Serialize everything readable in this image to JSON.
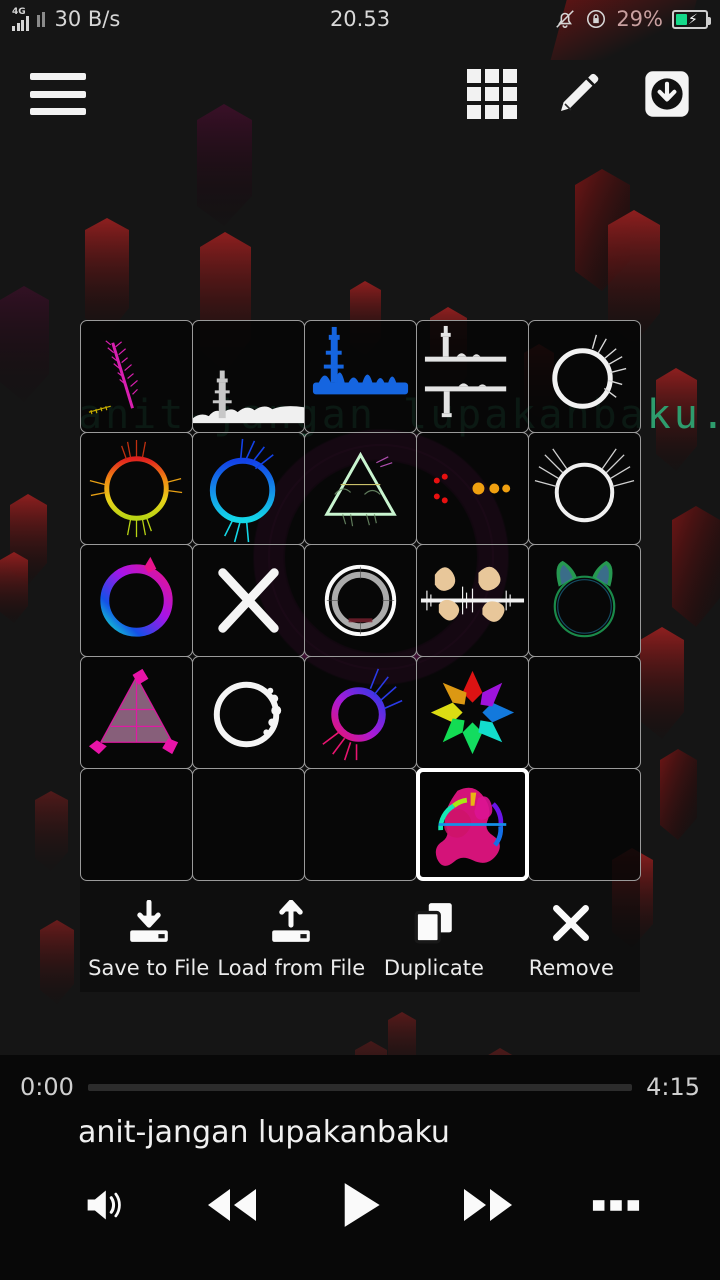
{
  "statusbar": {
    "network_type": "4G",
    "data_rate": "30 B/s",
    "clock": "20.53",
    "battery_percent": "29%",
    "icons": [
      "signal-bars-icon",
      "silent-bell-icon",
      "rotation-lock-icon",
      "battery-charging-icon"
    ]
  },
  "toolbar": {
    "menu_icon": "hamburger-menu-icon",
    "grid_icon": "grid-view-icon",
    "edit_icon": "pencil-edit-icon",
    "download_icon": "download-to-device-icon"
  },
  "watermark": {
    "text": "anit-jangan lupakanbaku.sx",
    "color": "#2e9c6d"
  },
  "preset_grid": {
    "columns": 5,
    "rows": 5,
    "selected_index": 23,
    "cells": [
      {
        "index": 0,
        "name": "diagonal-spectrum-bar",
        "empty": false
      },
      {
        "index": 1,
        "name": "snow-skyline-spectrum",
        "empty": false
      },
      {
        "index": 2,
        "name": "blue-skyline-spectrum",
        "empty": false
      },
      {
        "index": 3,
        "name": "grey-line-spectrum",
        "empty": false
      },
      {
        "index": 4,
        "name": "white-ring-spikes",
        "empty": false
      },
      {
        "index": 5,
        "name": "rainbow-ring-spikes",
        "empty": false
      },
      {
        "index": 6,
        "name": "blue-cyan-ring",
        "empty": false
      },
      {
        "index": 7,
        "name": "mint-triangle-wave",
        "empty": false
      },
      {
        "index": 8,
        "name": "red-orange-line-burst",
        "empty": false
      },
      {
        "index": 9,
        "name": "white-ring-wings",
        "empty": false
      },
      {
        "index": 10,
        "name": "pink-cyan-gradient-ring",
        "empty": false
      },
      {
        "index": 11,
        "name": "white-x-cross",
        "empty": false
      },
      {
        "index": 12,
        "name": "white-double-ring",
        "empty": false
      },
      {
        "index": 13,
        "name": "tan-waveform-mirror",
        "empty": false
      },
      {
        "index": 14,
        "name": "green-cat-ears-ring",
        "empty": false
      },
      {
        "index": 15,
        "name": "pink-triangle-mesh",
        "empty": false
      },
      {
        "index": 16,
        "name": "white-dotted-circle",
        "empty": false
      },
      {
        "index": 17,
        "name": "purple-ring-rays",
        "empty": false
      },
      {
        "index": 18,
        "name": "rainbow-star-burst",
        "empty": false
      },
      {
        "index": 19,
        "name": "empty-slot",
        "empty": true
      },
      {
        "index": 20,
        "name": "empty-slot",
        "empty": true
      },
      {
        "index": 21,
        "name": "empty-slot",
        "empty": true
      },
      {
        "index": 22,
        "name": "empty-slot",
        "empty": true
      },
      {
        "index": 23,
        "name": "magenta-splatter-preset",
        "empty": false
      },
      {
        "index": 24,
        "name": "empty-slot",
        "empty": true
      }
    ]
  },
  "actions": [
    {
      "label": "Save to File",
      "icon": "save-to-file-icon"
    },
    {
      "label": "Load from File",
      "icon": "load-from-file-icon"
    },
    {
      "label": "Duplicate",
      "icon": "duplicate-icon"
    },
    {
      "label": "Remove",
      "icon": "remove-x-icon"
    }
  ],
  "player": {
    "current_time": "0:00",
    "total_time": "4:15",
    "progress_percent": 0,
    "track_title": "anit-jangan lupakanbaku",
    "controls": [
      {
        "name": "volume-button",
        "icon": "speaker-volume-icon"
      },
      {
        "name": "rewind-button",
        "icon": "rewind-icon"
      },
      {
        "name": "play-button",
        "icon": "play-icon"
      },
      {
        "name": "forward-button",
        "icon": "fast-forward-icon"
      },
      {
        "name": "more-button",
        "icon": "more-options-icon"
      }
    ]
  },
  "theme": {
    "background": "#151515",
    "panel_bg": "#0a0a0a",
    "accent_magenta": "#a81f86",
    "shard_color": "#8e1515",
    "text": "#f0f0f0"
  }
}
